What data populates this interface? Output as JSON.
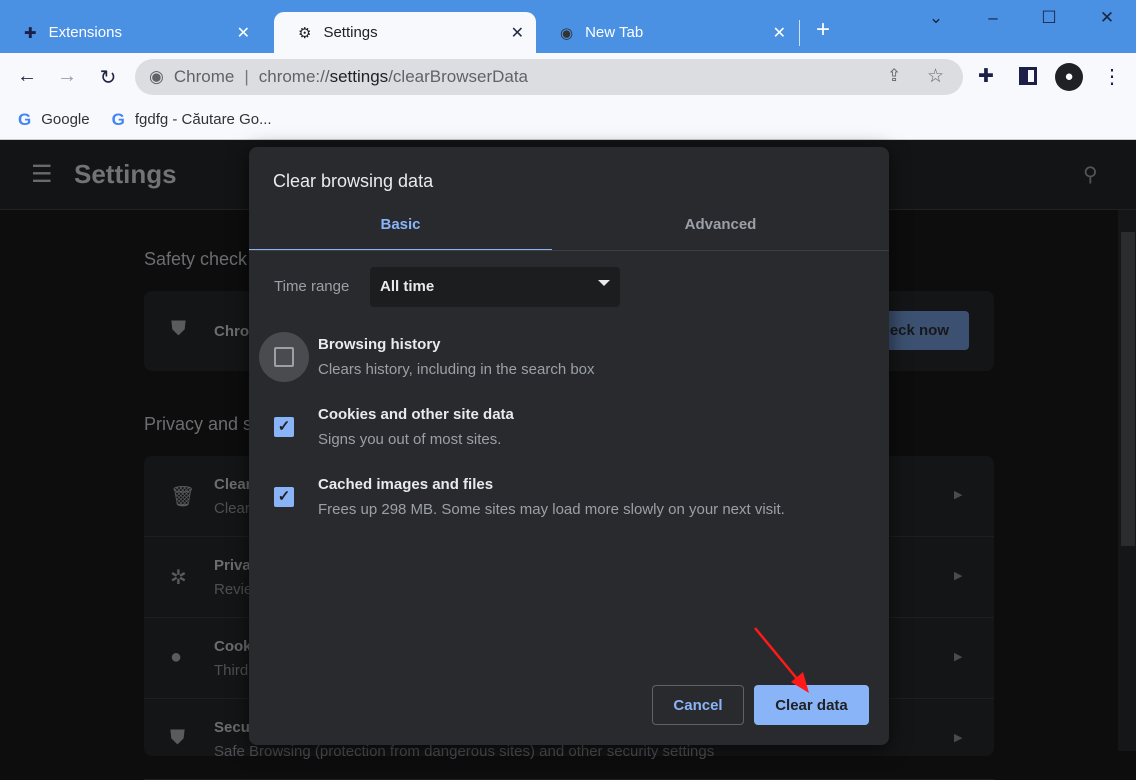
{
  "browser": {
    "tabs": [
      {
        "label": "Extensions",
        "icon": "puzzle-icon"
      },
      {
        "label": "Settings",
        "icon": "gear-icon"
      },
      {
        "label": "New Tab",
        "icon": "chrome-icon"
      }
    ],
    "omnibox": {
      "site": "Chrome",
      "url_prefix": "chrome://",
      "url_host": "settings",
      "url_path": "/clearBrowserData"
    },
    "bookmarks": [
      {
        "label": "Google"
      },
      {
        "label": "fgdfg - Căutare Go..."
      }
    ]
  },
  "settings": {
    "title": "Settings",
    "safety_check": {
      "heading": "Safety check",
      "row_text": "Chro",
      "button": "eck now"
    },
    "privacy": {
      "heading": "Privacy and s",
      "rows": [
        {
          "title": "Clear",
          "sub": "Clear"
        },
        {
          "title": "Priva",
          "sub": "Revie"
        },
        {
          "title": "Cook",
          "sub": "Third"
        },
        {
          "title": "Secu",
          "sub": "Safe Browsing (protection from dangerous sites) and other security settings"
        }
      ]
    }
  },
  "dialog": {
    "title": "Clear browsing data",
    "tabs": [
      "Basic",
      "Advanced"
    ],
    "time_range_label": "Time range",
    "time_range_value": "All time",
    "items": [
      {
        "title": "Browsing history",
        "sub": "Clears history, including in the search box",
        "checked": false
      },
      {
        "title": "Cookies and other site data",
        "sub": "Signs you out of most sites.",
        "checked": true
      },
      {
        "title": "Cached images and files",
        "sub": "Frees up 298 MB. Some sites may load more slowly on your next visit.",
        "checked": true
      }
    ],
    "cancel": "Cancel",
    "confirm": "Clear data"
  },
  "colors": {
    "accent": "#8ab4f8",
    "tabbar": "#4a90e3",
    "dialog_bg": "#292a2d"
  }
}
